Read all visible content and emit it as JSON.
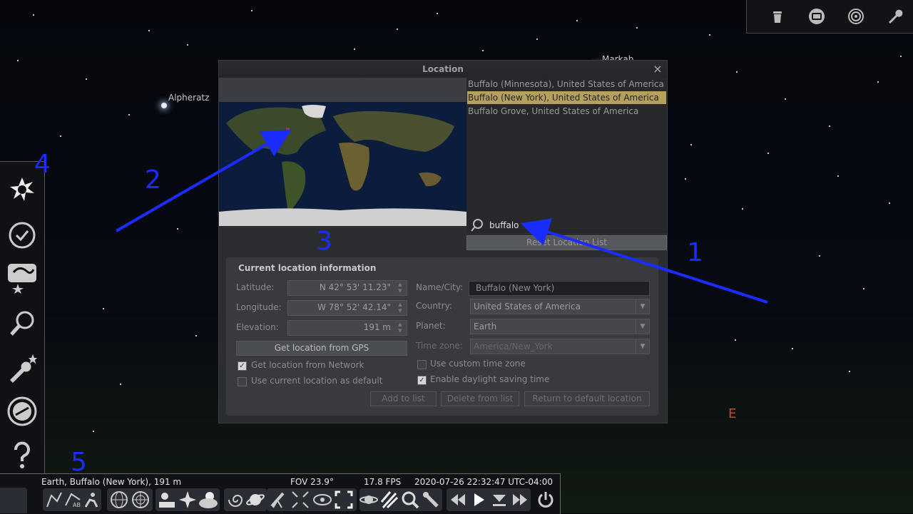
{
  "sky": {
    "stars": [
      {
        "name": "Alpheratz"
      },
      {
        "name": "Markab"
      }
    ],
    "compass_label": "E"
  },
  "dialog": {
    "title": "Location",
    "close": "×",
    "results": [
      {
        "label": "Buffalo (Minnesota), United States of America"
      },
      {
        "label": "Buffalo (New York), United States of America",
        "selected": true
      },
      {
        "label": "Buffalo Grove, United States of America"
      }
    ],
    "search": {
      "value": "buffalo"
    },
    "reset_button": "Reset Location List",
    "info": {
      "header": "Current location information",
      "latitude_label": "Latitude:",
      "latitude": "N 42° 53' 11.23\"",
      "longitude_label": "Longitude:",
      "longitude": "W 78° 52' 42.14\"",
      "elevation_label": "Elevation:",
      "elevation": "191 m",
      "gps_button": "Get location from GPS",
      "network_checkbox": "Get location from Network",
      "default_checkbox": "Use current location as default",
      "name_label": "Name/City:",
      "name": "Buffalo (New York)",
      "country_label": "Country:",
      "country": "United States of America",
      "planet_label": "Planet:",
      "planet": "Earth",
      "timezone_label": "Time zone:",
      "timezone": "America/New_York",
      "custom_tz_checkbox": "Use custom time zone",
      "dst_checkbox": "Enable daylight saving time",
      "add_button": "Add to list",
      "delete_button": "Delete from list",
      "return_button": "Return to default location"
    }
  },
  "statusbar": {
    "location": "Earth, Buffalo (New York), 191 m",
    "fov": "FOV 23.9°",
    "fps": "17.8 FPS",
    "datetime": "2020-07-26 22:32:47 UTC-04:00"
  },
  "annotations": [
    "1",
    "2",
    "3",
    "4",
    "5"
  ],
  "colors": {
    "annotation": "#1a2cff",
    "selection": "#b6a15c"
  }
}
